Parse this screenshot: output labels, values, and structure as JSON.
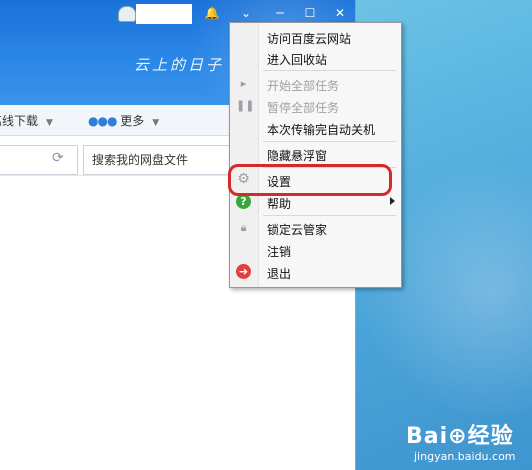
{
  "titlebar": {
    "slogan": "云上的日子",
    "buttons": [
      "🔔",
      "⌄",
      "─",
      "☐",
      "✕"
    ]
  },
  "toolbar": {
    "offline_download_label": "离线下载",
    "more_label": "更多"
  },
  "search": {
    "placeholder": "搜索我的网盘文件"
  },
  "menu": {
    "visit_site": "访问百度云网站",
    "recycle_bin": "进入回收站",
    "start_all": "开始全部任务",
    "pause_all": "暂停全部任务",
    "auto_shutdown": "本次传输完自动关机",
    "hide_float": "隐藏悬浮窗",
    "settings": "设置",
    "help": "帮助",
    "lock": "锁定云管家",
    "logout": "注销",
    "exit": "退出"
  },
  "watermark": {
    "logo": "Bai⊕经验",
    "sub": "jingyan.baidu.com"
  },
  "colors": {
    "titlebar": "#2a86e6",
    "highlight": "#d42a2a",
    "desktop": "#5fb9e2"
  }
}
